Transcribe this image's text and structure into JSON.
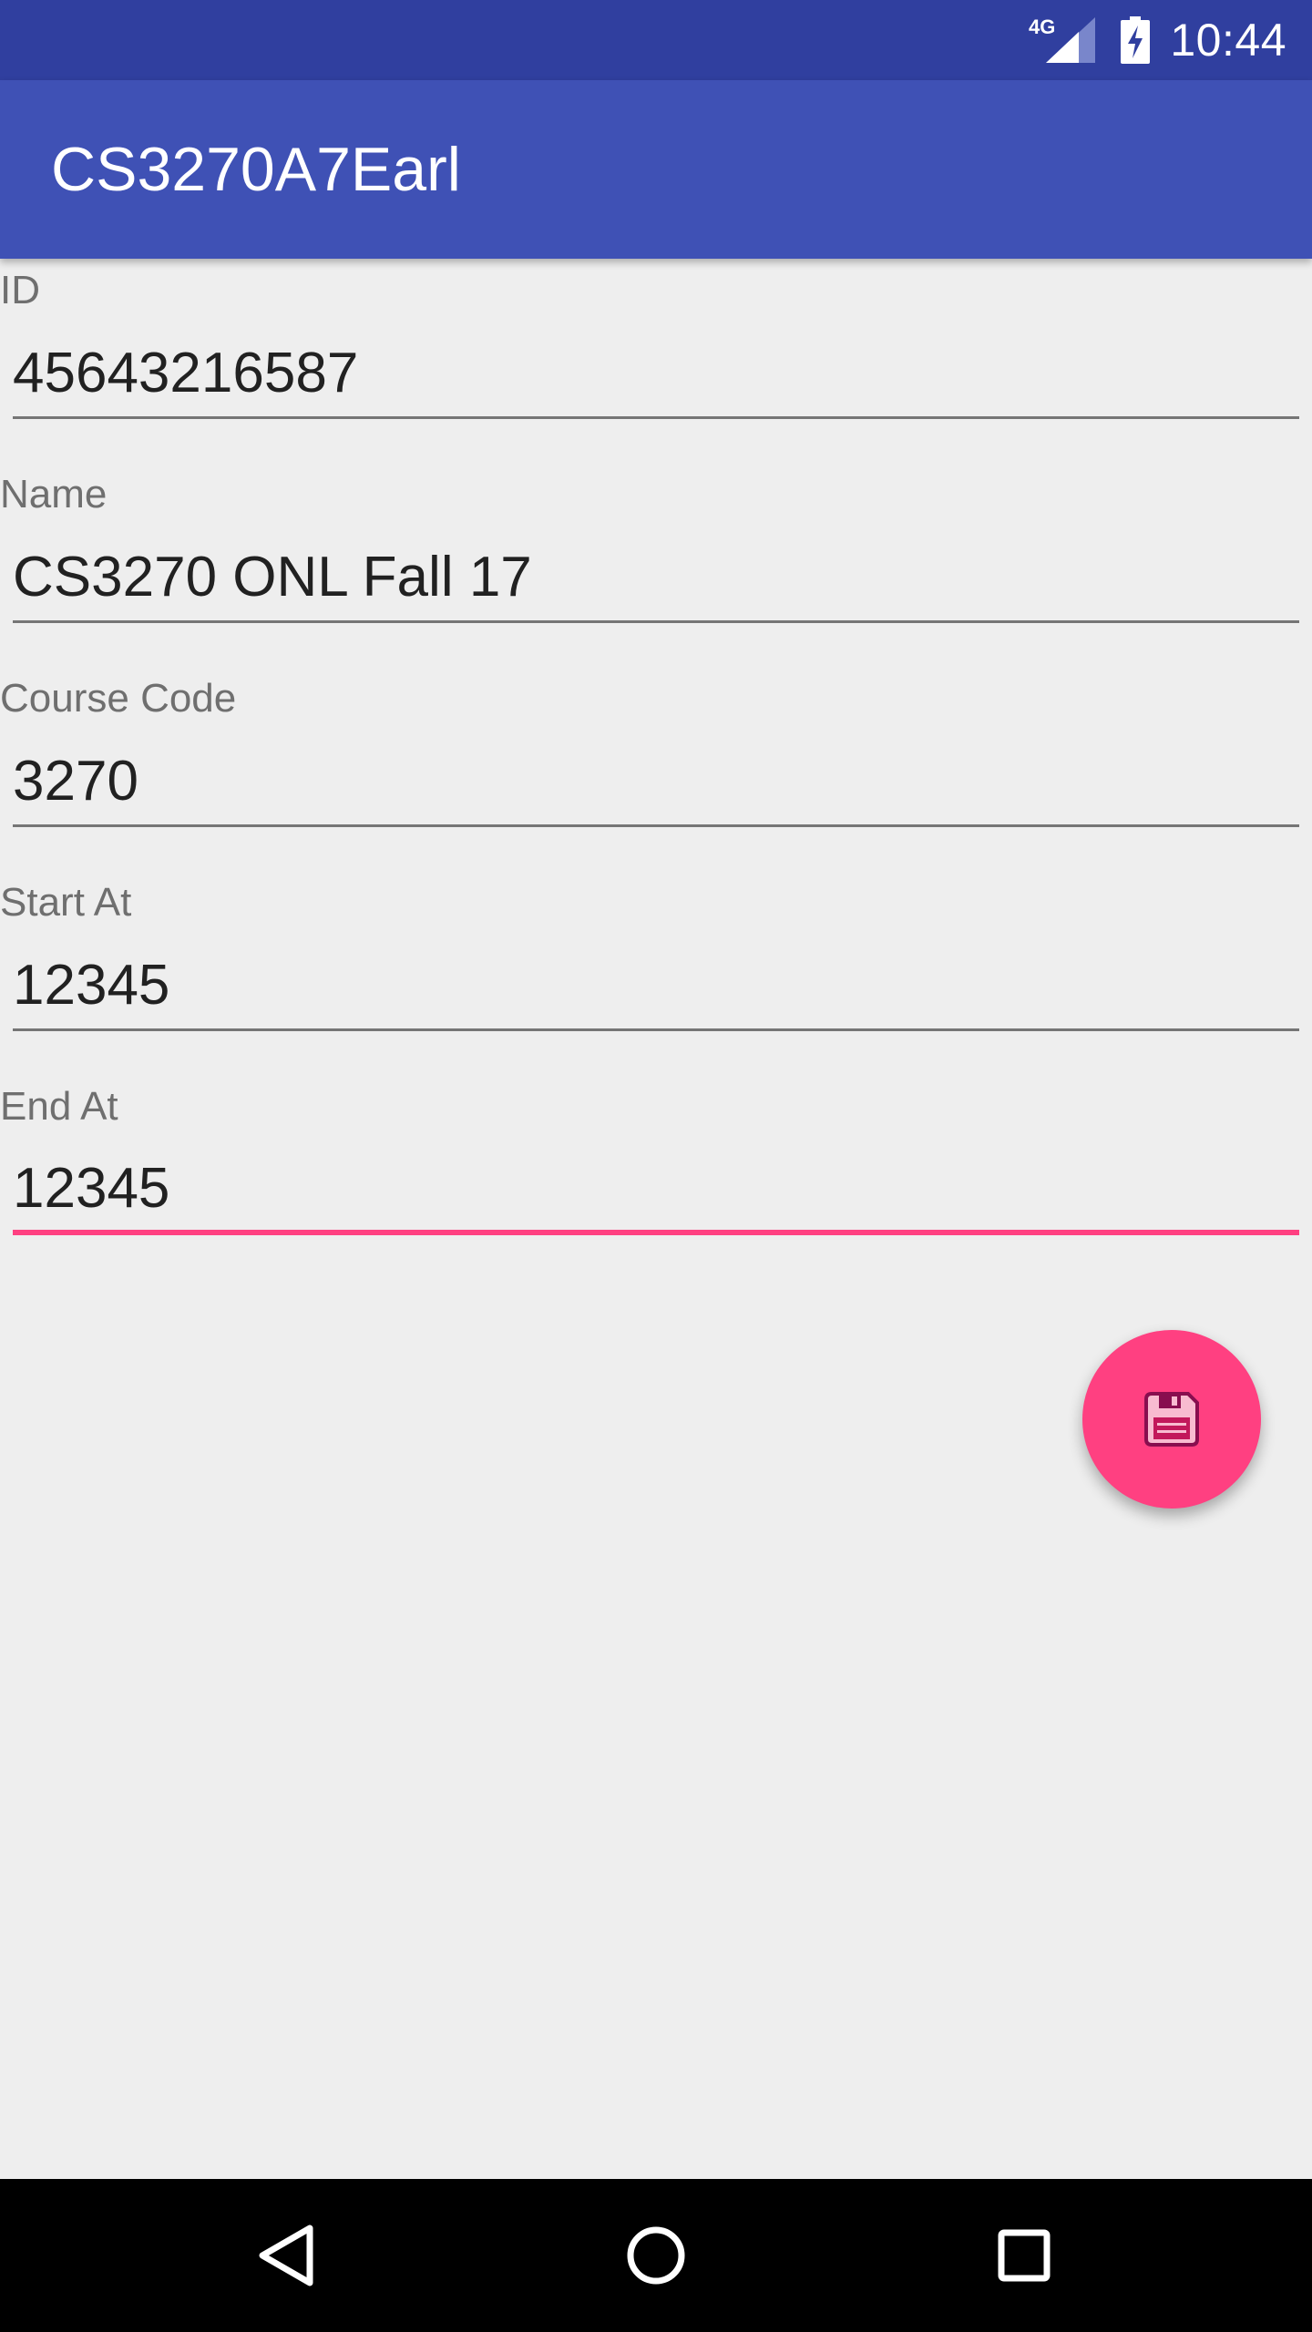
{
  "status_bar": {
    "network": "4G",
    "time": "10:44",
    "icons": [
      "signal-icon",
      "battery-charging-icon"
    ]
  },
  "app_bar": {
    "title": "CS3270A7Earl"
  },
  "form": {
    "fields": [
      {
        "label": "ID",
        "value": "45643216587"
      },
      {
        "label": "Name",
        "value": "CS3270 ONL Fall 17"
      },
      {
        "label": "Course Code",
        "value": "3270"
      },
      {
        "label": "Start At",
        "value": "12345"
      },
      {
        "label": "End At",
        "value": "12345"
      }
    ],
    "focused_field": "End At"
  },
  "fab": {
    "icon": "save-icon"
  },
  "colors": {
    "status_bar": "#303f9f",
    "primary": "#3f51b5",
    "accent": "#ff4081",
    "background": "#eeeeee"
  },
  "nav_bar": {
    "buttons": [
      "back-icon",
      "home-icon",
      "recents-icon"
    ]
  }
}
